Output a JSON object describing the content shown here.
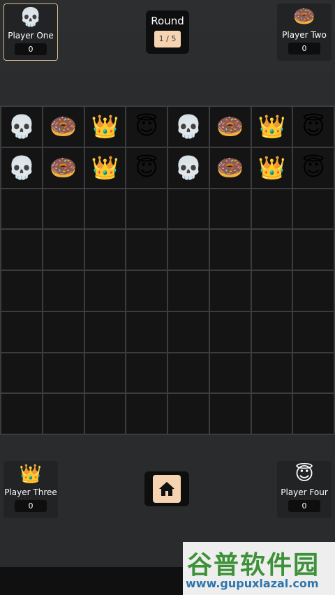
{
  "players": {
    "one": {
      "icon": "💀",
      "name": "Player One",
      "score": "0"
    },
    "two": {
      "icon": "🍩",
      "name": "Player Two",
      "score": "0"
    },
    "three": {
      "icon": "👑",
      "name": "Player Three",
      "score": "0"
    },
    "four": {
      "icon": "😇",
      "name": "Player Four",
      "score": "0"
    }
  },
  "round": {
    "label": "Round",
    "value": "1 / 5"
  },
  "board": {
    "rows": [
      [
        "💀",
        "🍩",
        "👑",
        "😇",
        "💀",
        "🍩",
        "👑",
        "😇"
      ],
      [
        "💀",
        "🍩",
        "👑",
        "😇",
        "💀",
        "🍩",
        "👑",
        "😇"
      ],
      [
        "",
        "",
        "",
        "",
        "",
        "",
        "",
        ""
      ],
      [
        "",
        "",
        "",
        "",
        "",
        "",
        "",
        ""
      ],
      [
        "",
        "",
        "",
        "",
        "",
        "",
        "",
        ""
      ],
      [
        "",
        "",
        "",
        "",
        "",
        "",
        "",
        ""
      ],
      [
        "",
        "",
        "",
        "",
        "",
        "",
        "",
        ""
      ],
      [
        "",
        "",
        "",
        "",
        "",
        "",
        "",
        ""
      ]
    ]
  },
  "home_button": {
    "icon": "home-icon"
  },
  "watermark": {
    "text_cn": "谷普软件园",
    "url": "www.gupuxlazal.com"
  }
}
